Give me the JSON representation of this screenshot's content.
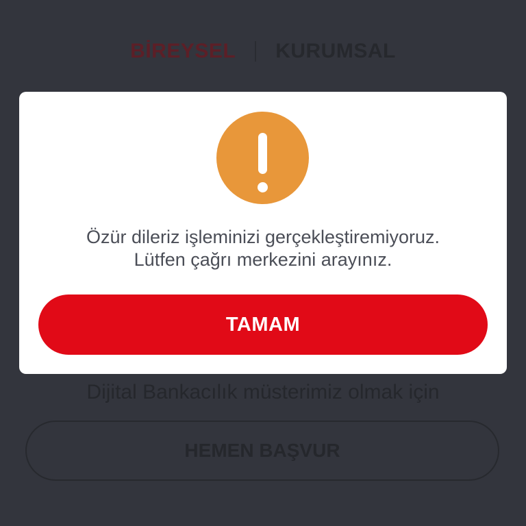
{
  "background": {
    "tabs": [
      {
        "label": "BİREYSEL",
        "active": true
      },
      {
        "label": "KURUMSAL",
        "active": false
      }
    ],
    "hint_text": "Dijital Bankacılık müsterimiz olmak için",
    "apply_button_label": "HEMEN BAŞVUR"
  },
  "dialog": {
    "icon": "exclamation-icon",
    "message_line1": "Özür dileriz işleminizi gerçekleştiremiyoruz.",
    "message_line2": "Lütfen çağrı merkezini arayınız.",
    "ok_button_label": "TAMAM"
  },
  "colors": {
    "overlay_background": "#33353d",
    "accent_red": "#e10a17",
    "warning_orange": "#e8973a",
    "text_gray": "#4b4e57"
  }
}
